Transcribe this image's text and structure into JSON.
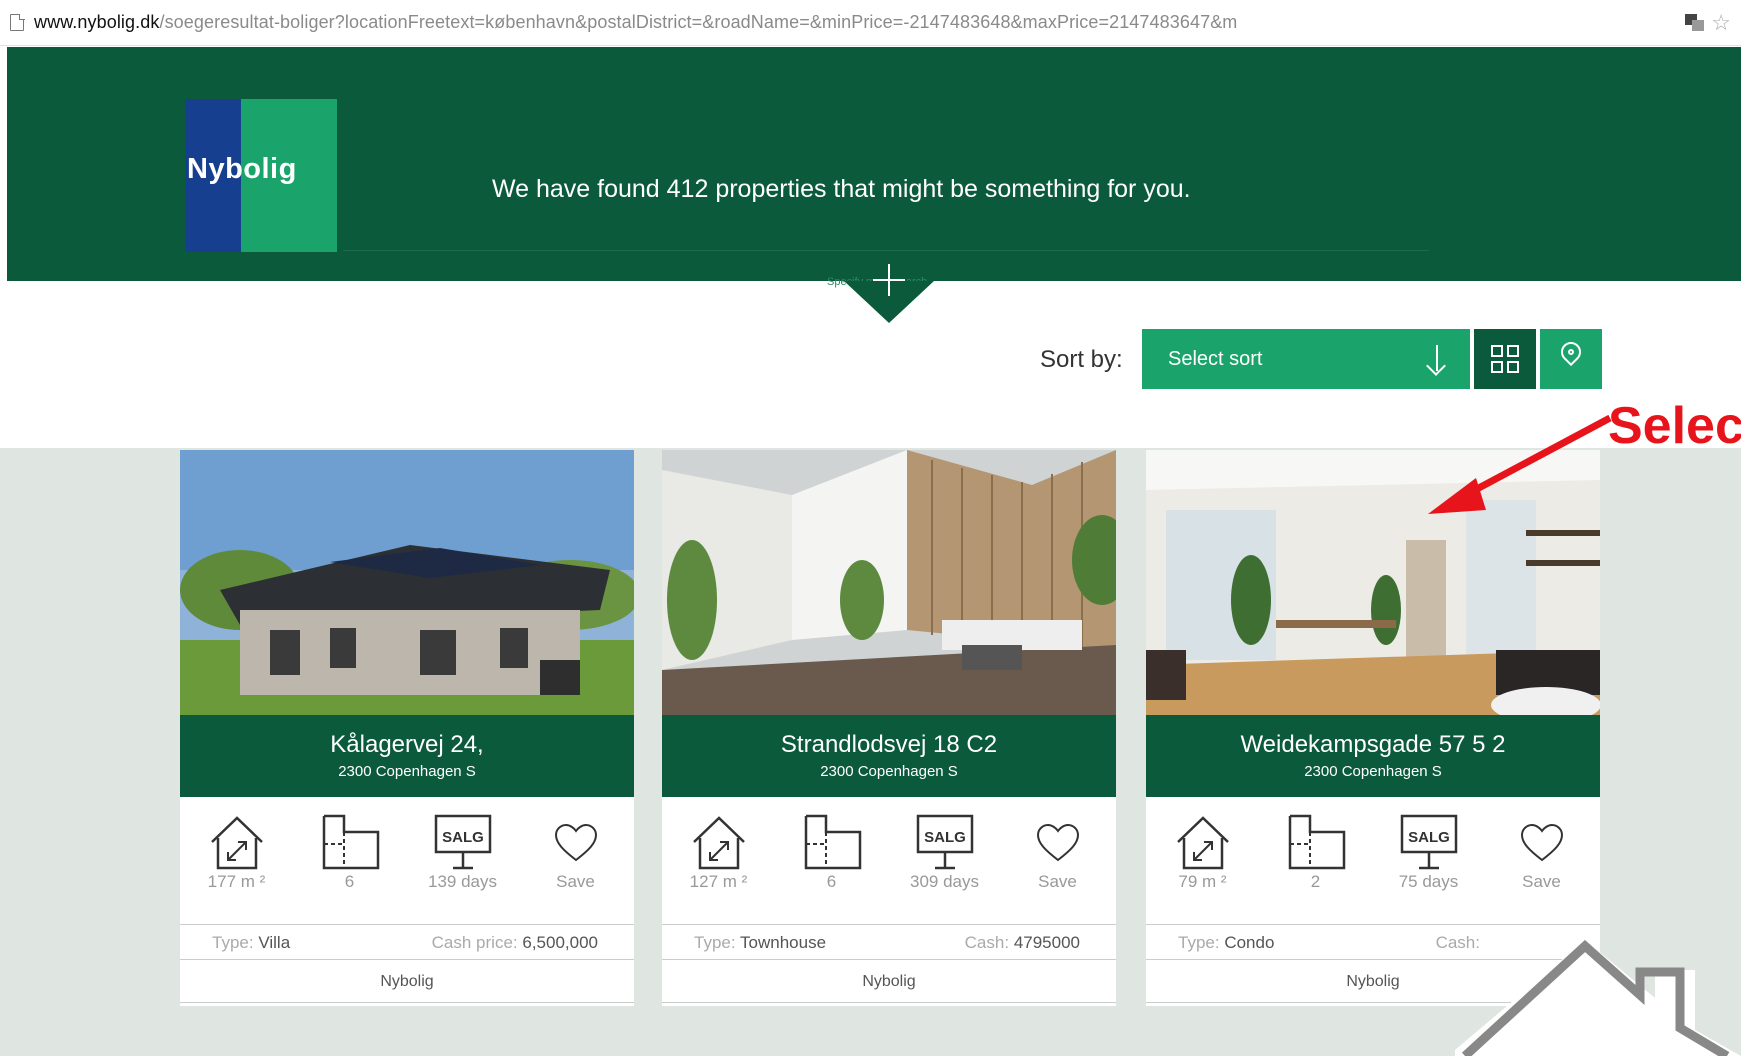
{
  "browser": {
    "url_host": "www.nybolig.dk",
    "url_path": "/soegeresultat-boliger?locationFreetext=københavn&postalDistrict=&roadName=&minPrice=-2147483648&maxPrice=2147483647&m"
  },
  "header": {
    "logo_text": "Nybolig",
    "headline": "We have found 412 properties that might be something for you.",
    "more_link": "Specify more search"
  },
  "sort": {
    "label": "Sort by:",
    "selected": "Select sort"
  },
  "annotation": {
    "text": "Select"
  },
  "cards": [
    {
      "street": "Kålagervej 24,",
      "city": "2300 Copenhagen S",
      "area": "177 m ²",
      "rooms": "6",
      "days": "139 days",
      "save": "Save",
      "type_label": "Type:",
      "type": "Villa",
      "price_label": "Cash price:",
      "price": "6,500,000",
      "broker": "Nybolig"
    },
    {
      "street": "Strandlodsvej 18 C2",
      "city": "2300 Copenhagen S",
      "area": "127 m ²",
      "rooms": "6",
      "days": "309 days",
      "save": "Save",
      "type_label": "Type:",
      "type": "Townhouse",
      "price_label": "Cash:",
      "price": "4795000",
      "broker": "Nybolig"
    },
    {
      "street": "Weidekampsgade 57 5 2",
      "city": "2300 Copenhagen S",
      "area": "79 m ²",
      "rooms": "2",
      "days": "75 days",
      "save": "Save",
      "type_label": "Type:",
      "type": "Condo",
      "price_label": "Cash:",
      "price": "",
      "broker": "Nybolig"
    }
  ],
  "colors": {
    "brand_dark_green": "#0b5a3c",
    "brand_green": "#1aa46c",
    "brand_blue": "#163f8f",
    "annotation_red": "#e8141b",
    "results_bg": "#dfe6e1"
  }
}
